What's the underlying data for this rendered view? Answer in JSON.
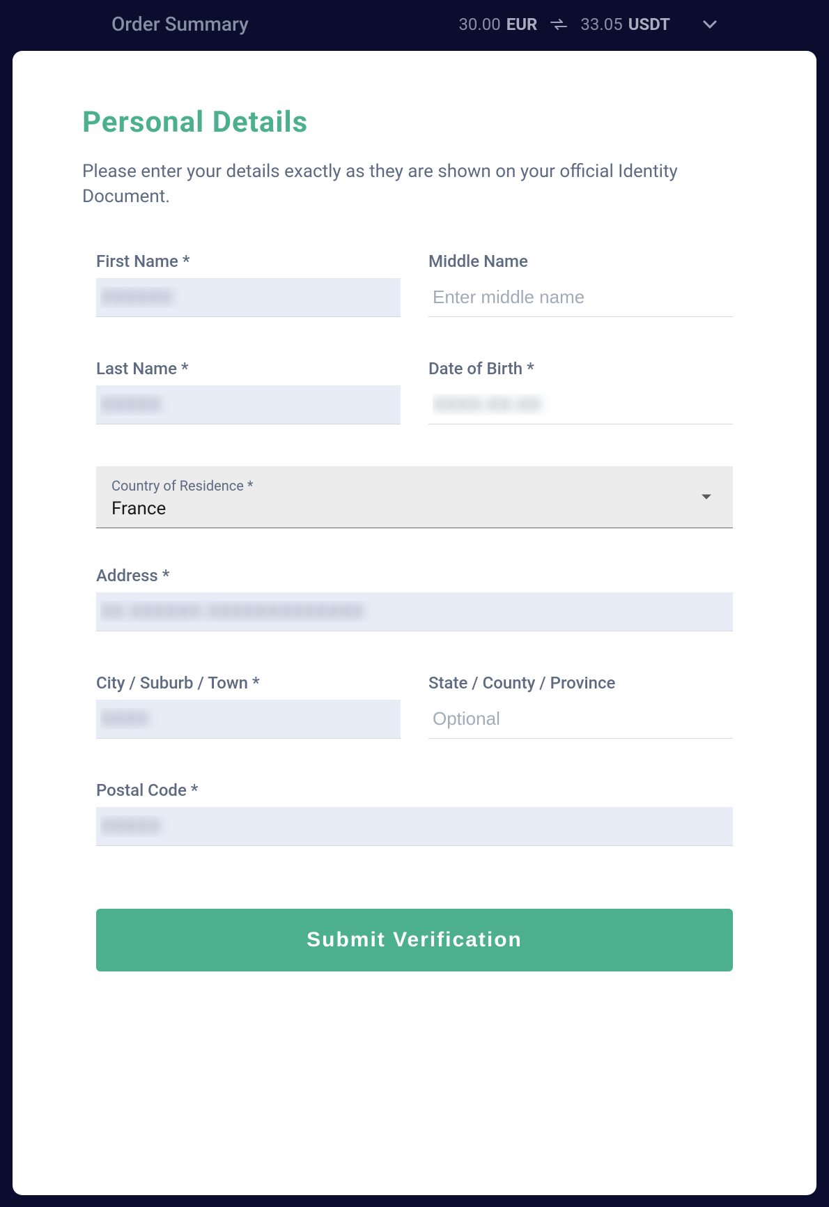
{
  "header": {
    "title": "Order Summary",
    "from_amount": "30.00",
    "from_currency": "EUR",
    "to_amount": "33.05",
    "to_currency": "USDT"
  },
  "form": {
    "heading": "Personal Details",
    "instructions": "Please enter your details exactly as they are shown on your official Identity Document.",
    "fields": {
      "first_name": {
        "label": "First Name *",
        "value": "XXXXXX"
      },
      "middle_name": {
        "label": "Middle Name",
        "placeholder": "Enter middle name",
        "value": ""
      },
      "last_name": {
        "label": "Last Name *",
        "value": "XXXXX"
      },
      "dob": {
        "label": "Date of Birth *",
        "value": "XXXX-XX-XX"
      },
      "country": {
        "label": "Country of Residence *",
        "value": "France"
      },
      "address": {
        "label": "Address *",
        "value": "XX XXXXXX XXXXXXXXXXXXX"
      },
      "city": {
        "label": "City / Suburb / Town *",
        "value": "XXXX"
      },
      "state": {
        "label": "State / County / Province",
        "placeholder": "Optional",
        "value": ""
      },
      "postal": {
        "label": "Postal Code *",
        "value": "XXXXX"
      }
    },
    "submit_label": "Submit Verification"
  }
}
